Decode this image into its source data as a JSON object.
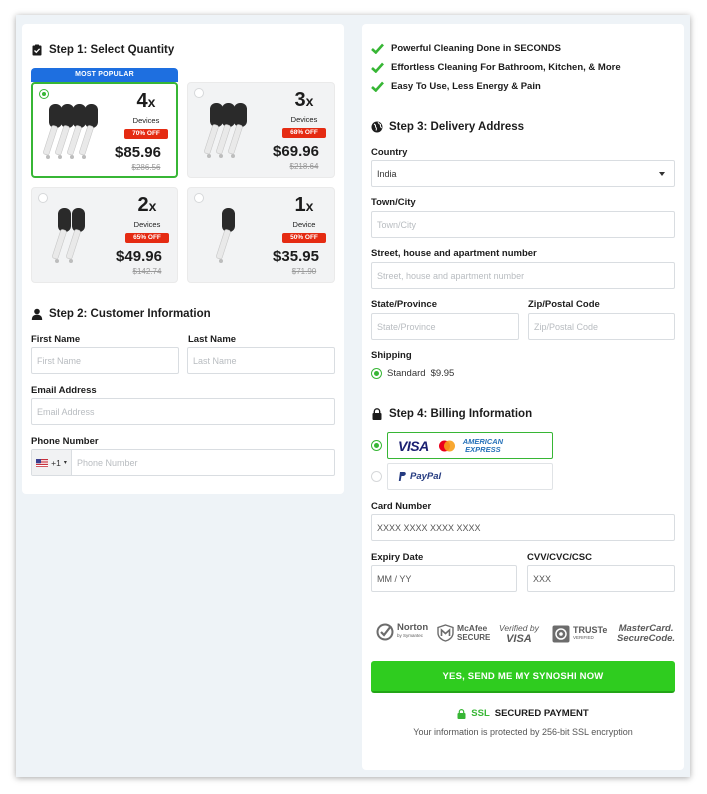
{
  "step1": {
    "title": "Step 1: Select Quantity",
    "popular_badge": "MOST POPULAR",
    "packages": [
      {
        "qty": "4",
        "x": "x",
        "unit": "Devices",
        "discount": "70% OFF",
        "price": "$85.96",
        "old_price": "$286.56",
        "selected": true
      },
      {
        "qty": "3",
        "x": "x",
        "unit": "Devices",
        "discount": "68% OFF",
        "price": "$69.96",
        "old_price": "$218.64",
        "selected": false
      },
      {
        "qty": "2",
        "x": "x",
        "unit": "Devices",
        "discount": "65% OFF",
        "price": "$49.96",
        "old_price": "$142.74",
        "selected": false
      },
      {
        "qty": "1",
        "x": "x",
        "unit": "Device",
        "discount": "50% OFF",
        "price": "$35.95",
        "old_price": "$71.90",
        "selected": false
      }
    ]
  },
  "step2": {
    "title": "Step 2: Customer Information",
    "first_name": {
      "label": "First Name",
      "placeholder": "First Name"
    },
    "last_name": {
      "label": "Last Name",
      "placeholder": "Last Name"
    },
    "email": {
      "label": "Email Address",
      "placeholder": "Email Address"
    },
    "phone": {
      "label": "Phone Number",
      "placeholder": "Phone Number",
      "country_code": "+1"
    }
  },
  "benefits": [
    "Powerful Cleaning Done in SECONDS",
    "Effortless Cleaning For Bathroom, Kitchen, & More",
    "Easy To Use, Less Energy & Pain"
  ],
  "step3": {
    "title": "Step 3: Delivery Address",
    "country": {
      "label": "Country",
      "value": "India"
    },
    "town": {
      "label": "Town/City",
      "placeholder": "Town/City"
    },
    "street": {
      "label": "Street, house and apartment number",
      "placeholder": "Street, house and apartment number"
    },
    "state": {
      "label": "State/Province",
      "placeholder": "State/Province"
    },
    "zip": {
      "label": "Zip/Postal Code",
      "placeholder": "Zip/Postal Code"
    },
    "shipping": {
      "label": "Shipping",
      "option": "Standard",
      "price": "$9.95"
    }
  },
  "step4": {
    "title": "Step 4: Billing Information",
    "cards_logo": {
      "visa": "VISA",
      "amex_line1": "AMERICAN",
      "amex_line2": "EXPRESS"
    },
    "paypal": "PayPal",
    "card_number": {
      "label": "Card Number",
      "placeholder": "XXXX XXXX XXXX XXXX"
    },
    "expiry": {
      "label": "Expiry Date",
      "placeholder": "MM / YY"
    },
    "cvv": {
      "label": "CVV/CVC/CSC",
      "placeholder": "XXX"
    }
  },
  "trust": {
    "norton": "Norton",
    "norton_sub": "by Symantec",
    "mcafee": "McAfee",
    "mcafee_sub": "SECURE",
    "verified_line1": "Verified by",
    "verified_line2": "VISA",
    "truste": "TRUSTe",
    "truste_sub": "VERIFIED",
    "mastercard_line1": "MasterCard.",
    "mastercard_line2": "SecureCode."
  },
  "cta": "YES, SEND ME MY SYNOSHI NOW",
  "ssl": {
    "prefix": "SSL",
    "label": "SECURED PAYMENT",
    "note": "Your information is protected by 256-bit SSL encryption"
  },
  "colors": {
    "accent_green": "#2fcc1f",
    "popular_blue": "#1e6fe0",
    "discount_red": "#e52b12"
  }
}
